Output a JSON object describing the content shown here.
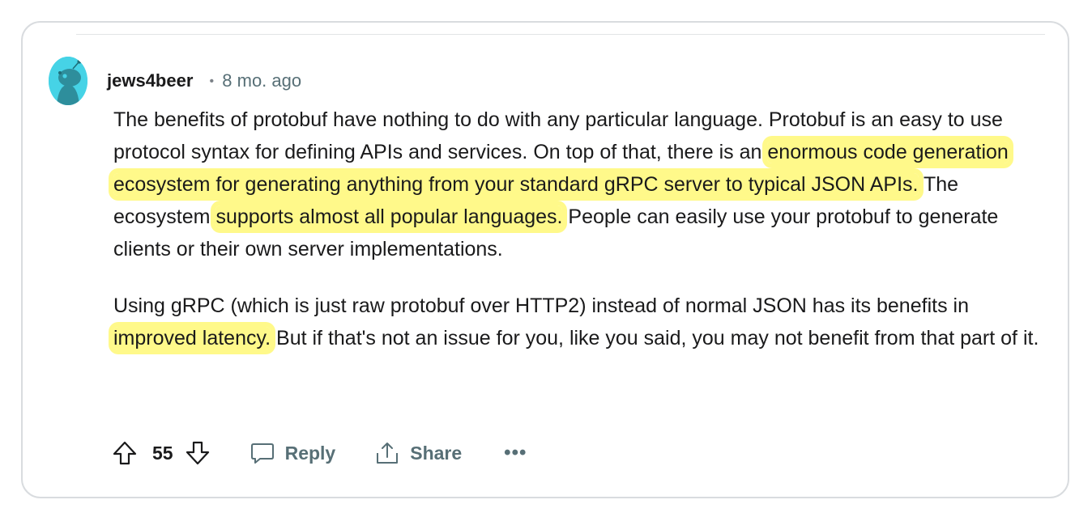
{
  "comment": {
    "author": "jews4beer",
    "separator": "•",
    "time": "8 mo. ago",
    "paragraphs": [
      [
        {
          "text": "The benefits of protobuf have nothing to do with any particular language. Protobuf is an easy to use protocol syntax for defining APIs and services. On top of that, there is an ",
          "highlight": false
        },
        {
          "text": "enormous code generation ecosystem for generating anything from your standard gRPC server to typical JSON APIs.",
          "highlight": true
        },
        {
          "text": " The ecosystem ",
          "highlight": false
        },
        {
          "text": "supports almost all popular languages.",
          "highlight": true
        },
        {
          "text": " People can easily use your protobuf to generate clients or their own server implementations.",
          "highlight": false
        }
      ],
      [
        {
          "text": "Using gRPC (which is just raw protobuf over HTTP2) instead of normal JSON has its benefits in ",
          "highlight": false
        },
        {
          "text": "improved latency.",
          "highlight": true
        },
        {
          "text": " But if that's not an issue for you, like you said, you may not benefit from that part of it.",
          "highlight": false
        }
      ]
    ],
    "highlight_color": "#fff98a"
  },
  "actions": {
    "score": "55",
    "reply_label": "Reply",
    "share_label": "Share",
    "more_label": "•••"
  }
}
